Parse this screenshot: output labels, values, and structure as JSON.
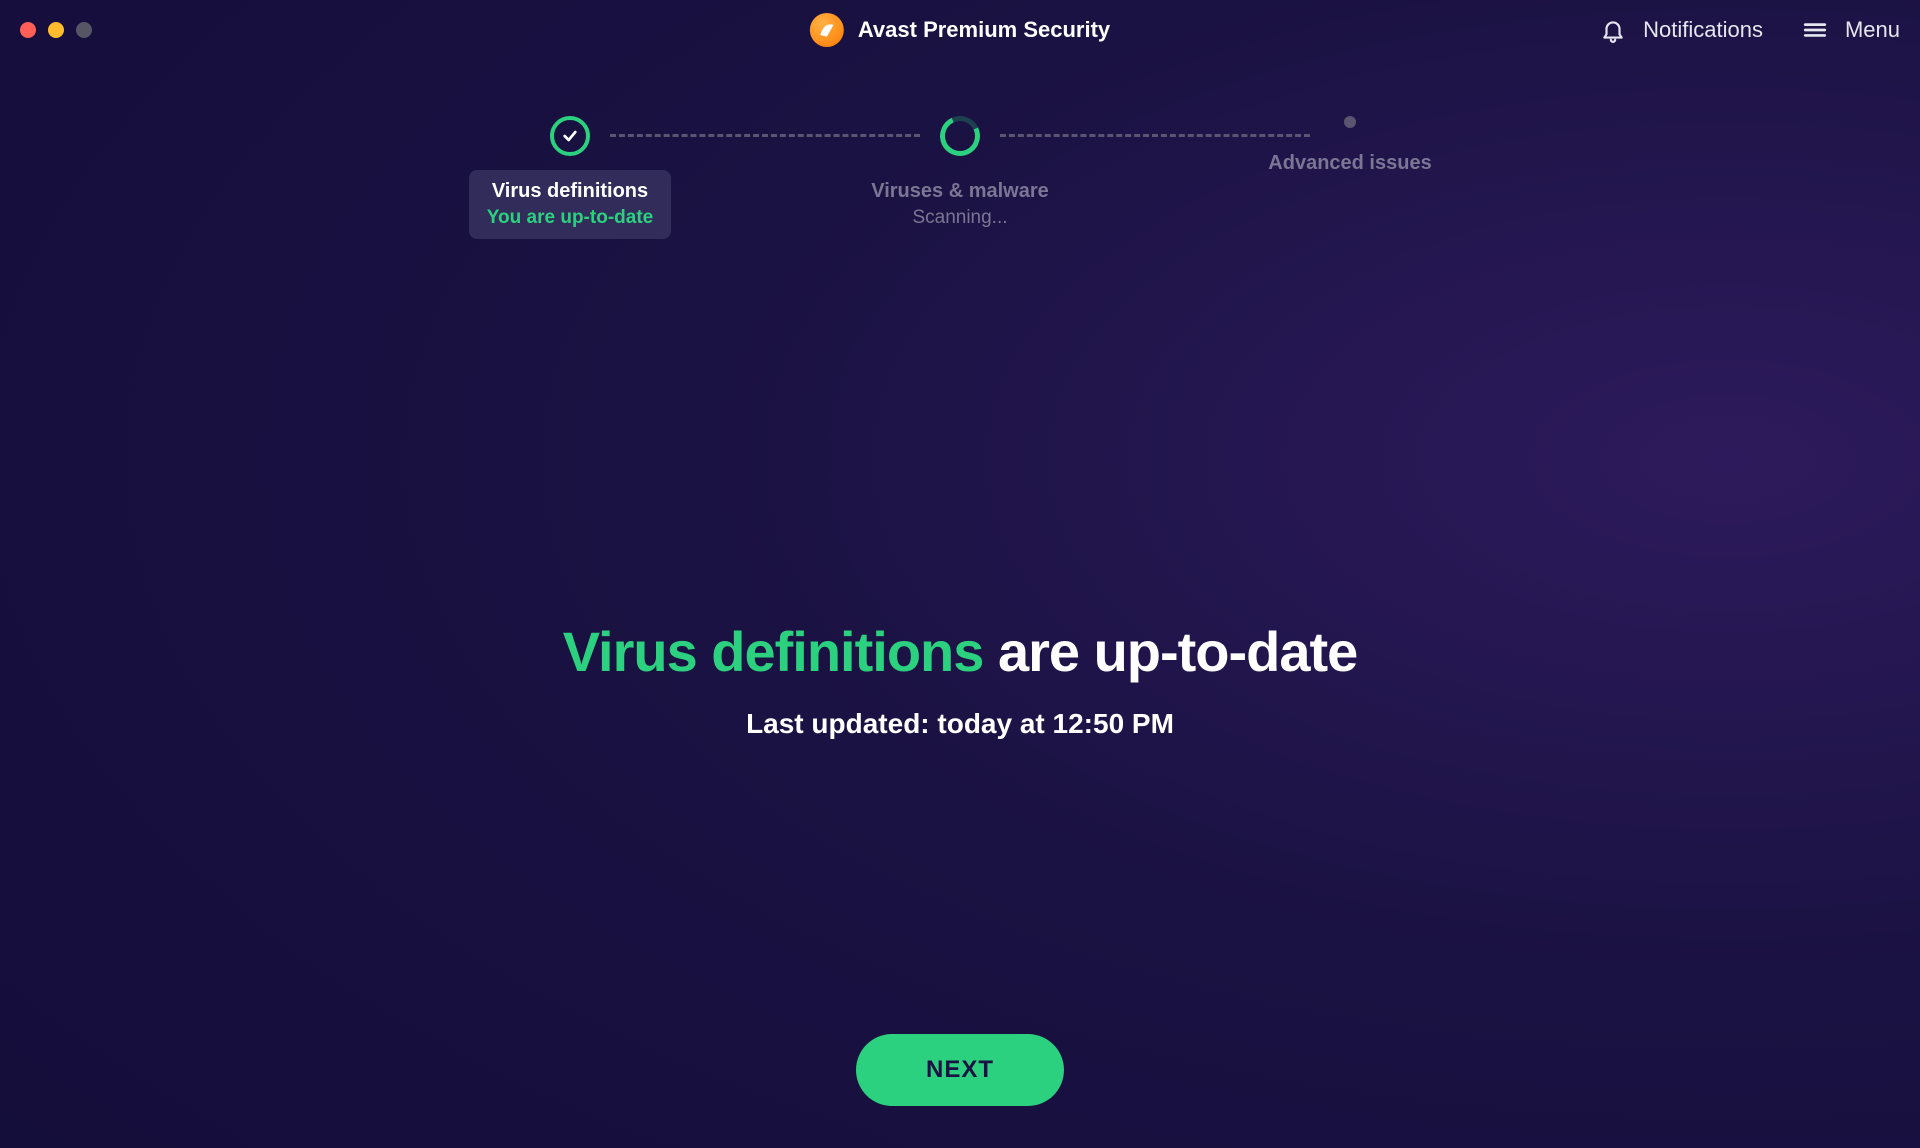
{
  "header": {
    "app_title": "Avast Premium Security",
    "notifications_label": "Notifications",
    "menu_label": "Menu"
  },
  "progress": {
    "steps": [
      {
        "title": "Virus definitions",
        "status": "You are up-to-date",
        "state": "complete"
      },
      {
        "title": "Viruses & malware",
        "status": "Scanning...",
        "state": "active"
      },
      {
        "title": "Advanced issues",
        "status": "",
        "state": "pending"
      }
    ]
  },
  "main": {
    "headline_green": "Virus definitions",
    "headline_white": " are up-to-date",
    "subline": "Last updated: today at 12:50 PM"
  },
  "action": {
    "next_label": "NEXT"
  },
  "colors": {
    "accent_green": "#2bd17e",
    "bg": "#1a1242"
  }
}
